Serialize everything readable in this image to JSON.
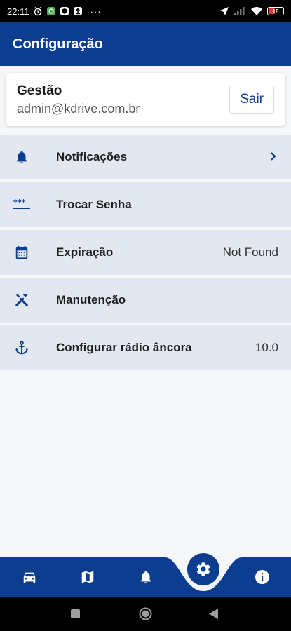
{
  "status_bar": {
    "time": "22:11",
    "battery": "18",
    "overflow": "···"
  },
  "header": {
    "title": "Configuração"
  },
  "account": {
    "name": "Gestão",
    "email": "admin@kdrive.com.br",
    "logout_label": "Sair"
  },
  "settings": {
    "items": [
      {
        "label": "Notificações",
        "icon": "bell-icon"
      },
      {
        "label": "Trocar Senha",
        "icon": "password-icon"
      },
      {
        "label": "Expiração",
        "value": "Not Found",
        "icon": "calendar-icon"
      },
      {
        "label": "Manutenção",
        "icon": "tools-icon"
      },
      {
        "label": "Configurar rádio âncora",
        "value": "10.0",
        "icon": "anchor-icon"
      }
    ]
  },
  "bottom_nav": {
    "items": [
      "car-icon",
      "map-icon",
      "bell-icon",
      "gear-icon",
      "info-icon"
    ],
    "active": "gear-icon"
  },
  "colors": {
    "primary": "#0c3d91",
    "list_bg": "#e3e7ef",
    "page_bg": "#f5f6f8"
  }
}
